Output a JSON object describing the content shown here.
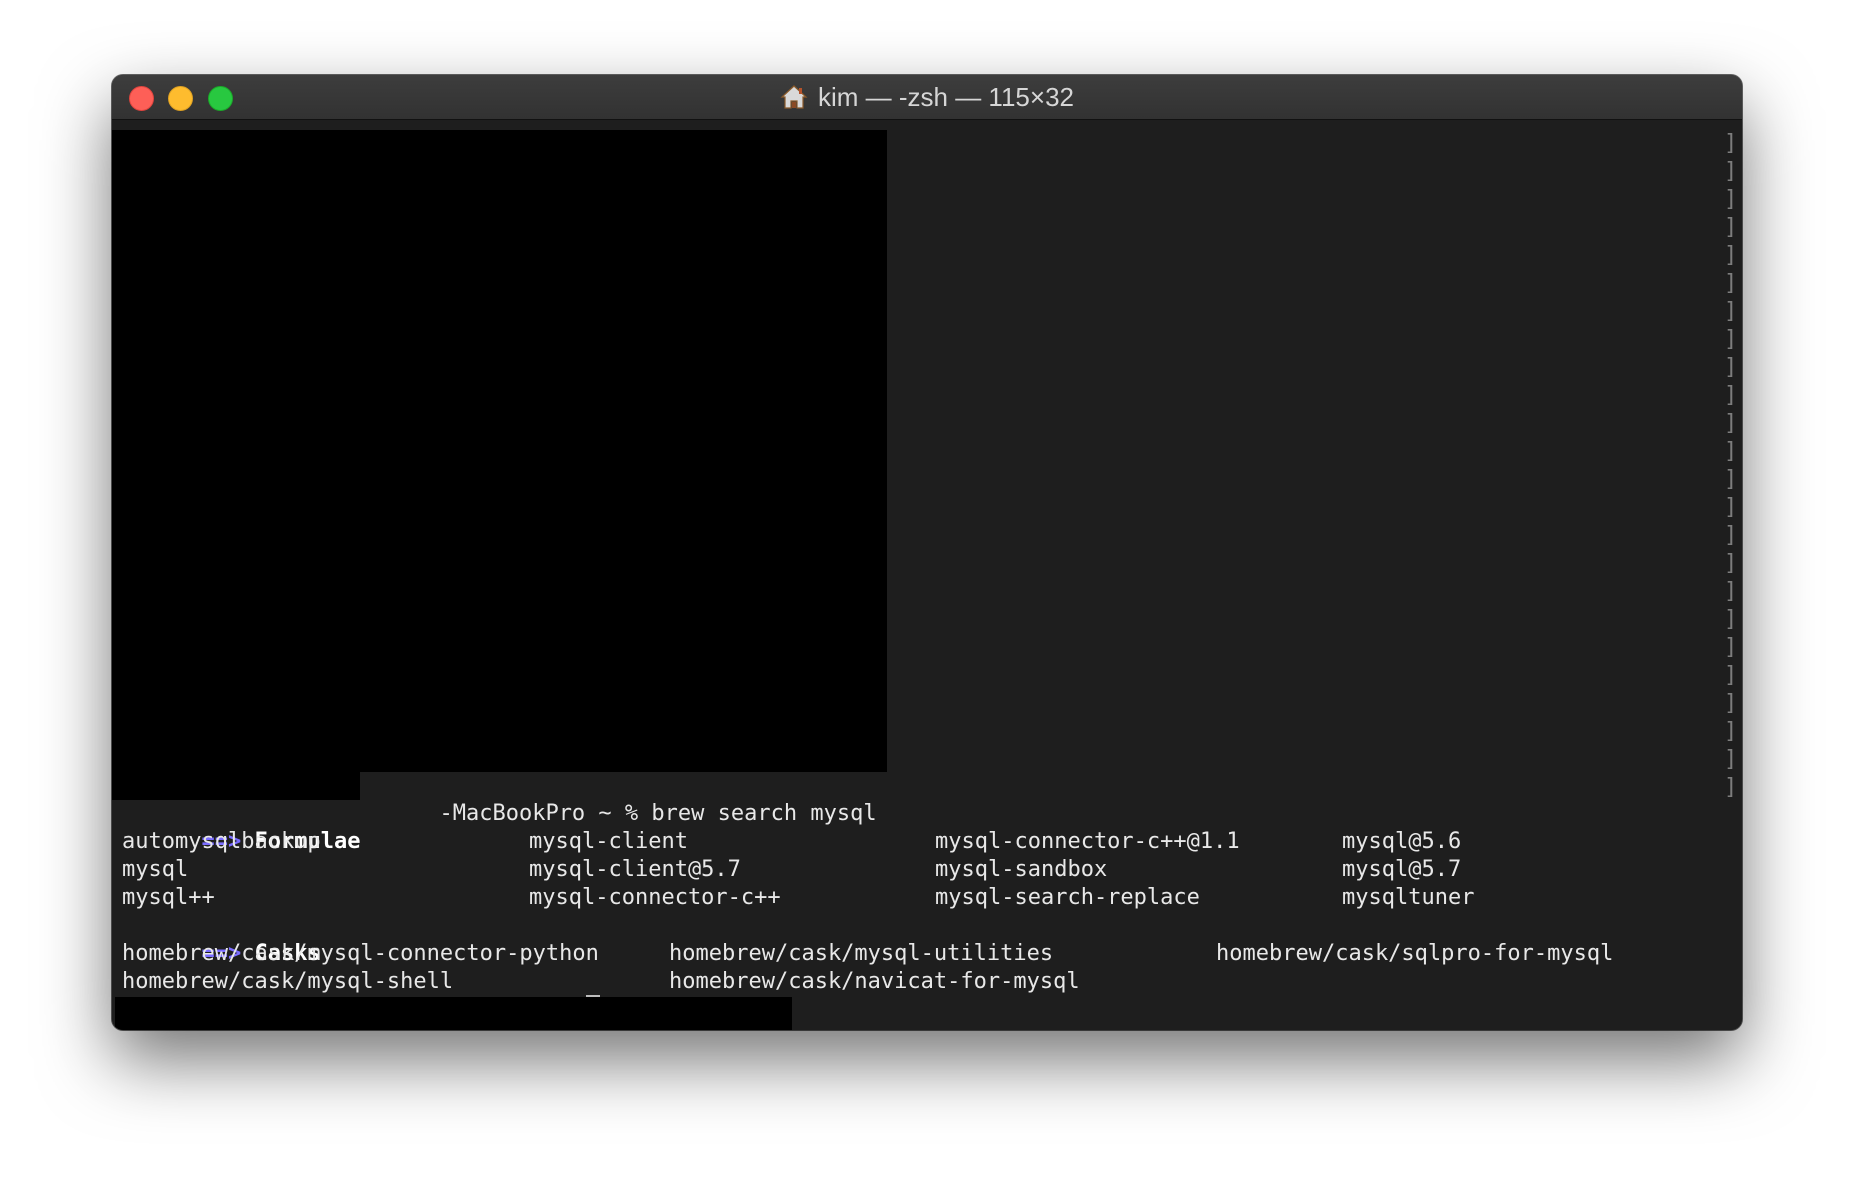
{
  "window": {
    "title": "kim — -zsh — 115×32",
    "title_icon": "home-icon"
  },
  "terminal": {
    "prompt_suffix": "-MacBookPro ~ % brew search mysql",
    "formulae_arrow": "==>",
    "formulae_heading": "Formulae",
    "formulae_rows": [
      [
        "automysqlbackup",
        "mysql-client",
        "mysql-connector-c++@1.1",
        "mysql@5.6"
      ],
      [
        "mysql",
        "mysql-client@5.7",
        "mysql-sandbox",
        "mysql@5.7"
      ],
      [
        "mysql++",
        "mysql-connector-c++",
        "mysql-search-replace",
        "mysqltuner"
      ]
    ],
    "casks_arrow": "==>",
    "casks_heading": "Casks",
    "casks_rows": [
      [
        "homebrew/cask/mysql-connector-python",
        "homebrew/cask/mysql-utilities",
        "homebrew/cask/sqlpro-for-mysql"
      ],
      [
        "homebrew/cask/mysql-shell",
        "homebrew/cask/navicat-for-mysql",
        ""
      ]
    ],
    "scroll_mark": "]"
  },
  "colors": {
    "background": "#1e1e1e",
    "text": "#e8e8e8",
    "arrow": "#7a6cff",
    "redacted": "#000000"
  }
}
